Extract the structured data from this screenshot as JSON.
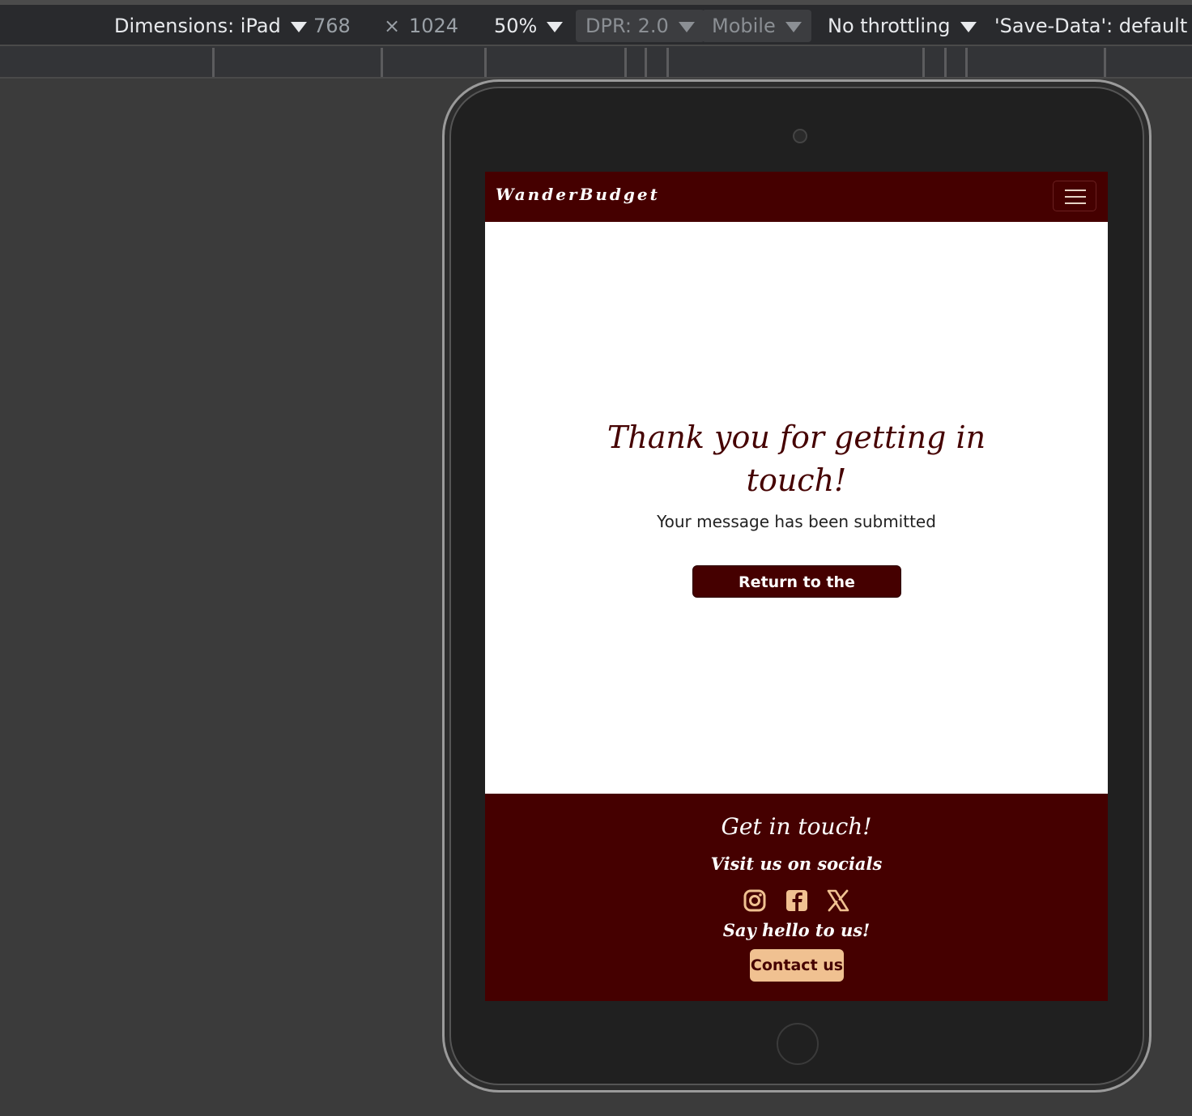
{
  "devtools": {
    "dimensions_label": "Dimensions: iPad",
    "width": "768",
    "times": "×",
    "height": "1024",
    "zoom": "50%",
    "dpr": "DPR: 2.0",
    "device_type": "Mobile",
    "throttling": "No throttling",
    "save_data": "'Save-Data': default"
  },
  "site": {
    "brand": "WanderBudget",
    "thanks_line1": "Thank you for getting in",
    "thanks_line2": "touch!",
    "submitted": "Your message has been submitted",
    "home_button": "Return to the Homepage",
    "footer": {
      "heading": "Get in touch!",
      "socials_label": "Visit us on socials",
      "hello_label": "Say hello to us!",
      "contact_button": "Contact us",
      "icons": [
        "instagram-icon",
        "facebook-icon",
        "x-twitter-icon"
      ]
    }
  },
  "colors": {
    "brand_dark": "#450000",
    "accent": "#f0c191"
  }
}
